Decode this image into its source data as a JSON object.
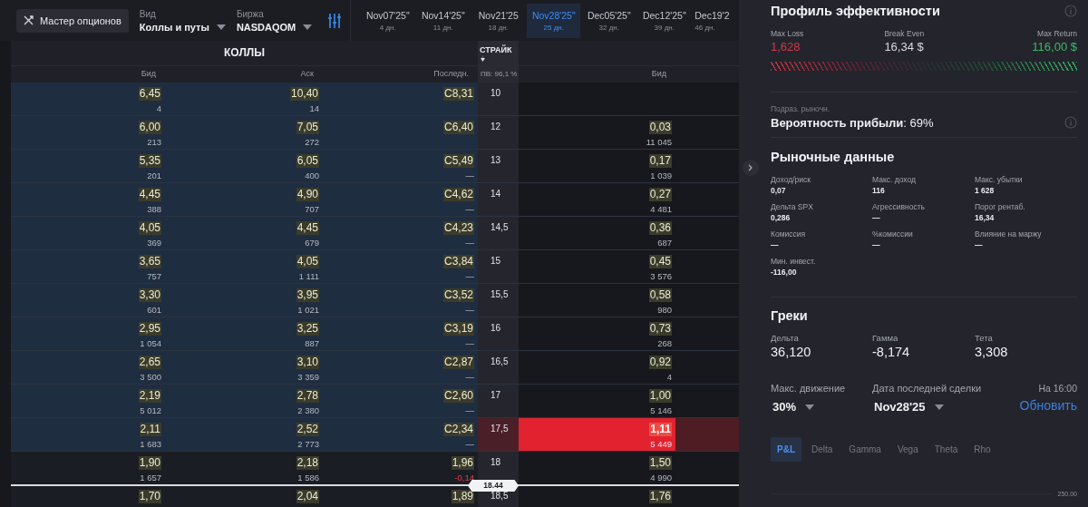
{
  "toolbar": {
    "wizard_button": "Мастер опционов",
    "view": {
      "label": "Вид",
      "value": "Коллы и путы"
    },
    "exchange": {
      "label": "Биржа",
      "value": "NASDAQOM"
    }
  },
  "expirations": [
    {
      "date": "Nov07'25\"",
      "days": "4 дн.",
      "selected": false
    },
    {
      "date": "Nov14'25\"",
      "days": "11 дн.",
      "selected": false
    },
    {
      "date": "Nov21'25",
      "days": "18 дн.",
      "selected": false
    },
    {
      "date": "Nov28'25\"",
      "days": "25 дн.",
      "selected": true
    },
    {
      "date": "Dec05'25\"",
      "days": "32 дн.",
      "selected": false
    },
    {
      "date": "Dec12'25\"",
      "days": "39 дн.",
      "selected": false
    },
    {
      "date": "Dec19'2",
      "days": "46 дн.",
      "selected": false
    }
  ],
  "chain": {
    "calls_title": "КОЛЛЫ",
    "strike_title": "СТРАЙК",
    "iv": "ПВ: 96,1 %",
    "call_columns": [
      "Бид",
      "Аск",
      "Последн."
    ],
    "put_columns": [
      "Бид"
    ],
    "rows": [
      {
        "call_bid": "6,45",
        "call_bid_size": "4",
        "call_ask": "10,40",
        "call_ask_size": "14",
        "call_last": "C8,31",
        "strike": "10",
        "itm": true,
        "selected": false
      },
      {
        "call_bid": "6,00",
        "call_bid_size": "213",
        "call_ask": "7,05",
        "call_ask_size": "272",
        "call_last": "C6,40",
        "strike": "12",
        "put_bid": "0,03",
        "put_bid_size": "11 045",
        "itm": true,
        "selected": false
      },
      {
        "call_bid": "5,35",
        "call_bid_size": "201",
        "call_ask": "6,05",
        "call_ask_size": "400",
        "call_last": "C5,49",
        "call_change": "—",
        "change_down": false,
        "strike": "13",
        "put_bid": "0,17",
        "put_bid_size": "1 039",
        "itm": true,
        "selected": false
      },
      {
        "call_bid": "4,45",
        "call_bid_size": "388",
        "call_ask": "4,90",
        "call_ask_size": "707",
        "call_last": "C4,62",
        "call_change": "—",
        "change_down": false,
        "strike": "14",
        "put_bid": "0,27",
        "put_bid_size": "4 481",
        "itm": true,
        "selected": false
      },
      {
        "call_bid": "4,05",
        "call_bid_size": "369",
        "call_ask": "4,45",
        "call_ask_size": "679",
        "call_last": "C4,23",
        "call_change": "—",
        "change_down": false,
        "strike": "14,5",
        "put_bid": "0,36",
        "put_bid_size": "687",
        "itm": true,
        "selected": false
      },
      {
        "call_bid": "3,65",
        "call_bid_size": "757",
        "call_ask": "4,05",
        "call_ask_size": "1 111",
        "call_last": "C3,84",
        "call_change": "—",
        "change_down": false,
        "strike": "15",
        "put_bid": "0,45",
        "put_bid_size": "3 576",
        "itm": true,
        "selected": false
      },
      {
        "call_bid": "3,30",
        "call_bid_size": "601",
        "call_ask": "3,95",
        "call_ask_size": "1 021",
        "call_last": "C3,52",
        "call_change": "—",
        "change_down": false,
        "strike": "15,5",
        "put_bid": "0,58",
        "put_bid_size": "980",
        "itm": true,
        "selected": false
      },
      {
        "call_bid": "2,95",
        "call_bid_size": "1 054",
        "call_ask": "3,25",
        "call_ask_size": "887",
        "call_last": "C3,19",
        "call_change": "—",
        "change_down": false,
        "strike": "16",
        "put_bid": "0,73",
        "put_bid_size": "268",
        "itm": true,
        "selected": false
      },
      {
        "call_bid": "2,65",
        "call_bid_size": "3 500",
        "call_ask": "3,10",
        "call_ask_size": "3 359",
        "call_last": "C2,87",
        "call_change": "—",
        "change_down": false,
        "strike": "16,5",
        "put_bid": "0,92",
        "put_bid_size": "4",
        "itm": true,
        "selected": false
      },
      {
        "call_bid": "2,19",
        "call_bid_size": "5 012",
        "call_ask": "2,78",
        "call_ask_size": "2 380",
        "call_last": "C2,60",
        "call_change": "—",
        "change_down": false,
        "strike": "17",
        "put_bid": "1,00",
        "put_bid_size": "5 146",
        "itm": true,
        "selected": false
      },
      {
        "call_bid": "2,11",
        "call_bid_size": "1 683",
        "call_ask": "2,52",
        "call_ask_size": "2 773",
        "call_last": "C2,34",
        "call_change": "—",
        "change_down": false,
        "strike": "17,5",
        "put_bid": "1,11",
        "put_bid_size": "5 449",
        "itm": true,
        "selected": true
      },
      {
        "call_bid": "1,90",
        "call_bid_size": "1 657",
        "call_ask": "2,18",
        "call_ask_size": "1 586",
        "call_last": "1,96",
        "call_change": "-0,14",
        "change_down": true,
        "strike": "18",
        "put_bid": "1,50",
        "put_bid_size": "4 990",
        "itm": false,
        "selected": false,
        "underlying_price": "18.44"
      },
      {
        "call_bid": "1,70",
        "call_ask": "2,04",
        "call_last": "1,89",
        "strike": "18,5",
        "put_bid": "1,76",
        "itm": false,
        "selected": false
      }
    ]
  },
  "panel": {
    "profile": {
      "title": "Профиль эффективности",
      "stats": [
        {
          "label": "Max Loss",
          "value": "1,628",
          "color": "#d23a47"
        },
        {
          "label": "Break Even",
          "value": "16,34 $",
          "color": "#d9dbdf"
        },
        {
          "label": "Max Return",
          "value": "116,00 $",
          "color": "#3fb866"
        }
      ]
    },
    "probability": {
      "caption": "Подраз. рыночн.",
      "text": "**Вероятность прибыли**: 69%"
    },
    "market": {
      "title": "Рыночные данные",
      "items": [
        {
          "label": "Доход/риск",
          "value": "0,07"
        },
        {
          "label": "Макс. доход",
          "value": "116"
        },
        {
          "label": "Макс. убытки",
          "value": "1 628"
        },
        {
          "label": "Дельта SPX",
          "value": "0,286"
        },
        {
          "label": "Агрессивность",
          "value": "—"
        },
        {
          "label": "Порог рентаб.",
          "value": "16,34"
        },
        {
          "label": "Комиссия",
          "value": "—"
        },
        {
          "label": "%комиссии",
          "value": "—"
        },
        {
          "label": "Влияние на маржу",
          "value": "—"
        },
        {
          "label": "Мин. инвест.",
          "value": "-116,00"
        }
      ]
    },
    "greeks": {
      "title": "Греки",
      "items": [
        {
          "label": "Дельта",
          "value": "36,120"
        },
        {
          "label": "Гамма",
          "value": "-8,174"
        },
        {
          "label": "Тета",
          "value": "3,308"
        }
      ]
    },
    "max_move": {
      "label": "Макс. движение",
      "value": "30%"
    },
    "last_trade_date": {
      "label": "Дата последней сделки",
      "value": "Nov28'25"
    },
    "as_of": "На 16:00",
    "refresh_link": "Обновить",
    "chart_tabs": [
      {
        "label": "P&L",
        "selected": true
      },
      {
        "label": "Delta",
        "selected": false
      },
      {
        "label": "Gamma",
        "selected": false
      },
      {
        "label": "Vega",
        "selected": false
      },
      {
        "label": "Theta",
        "selected": false
      },
      {
        "label": "Rho",
        "selected": false
      }
    ],
    "chart_axis_label": "250.00"
  }
}
